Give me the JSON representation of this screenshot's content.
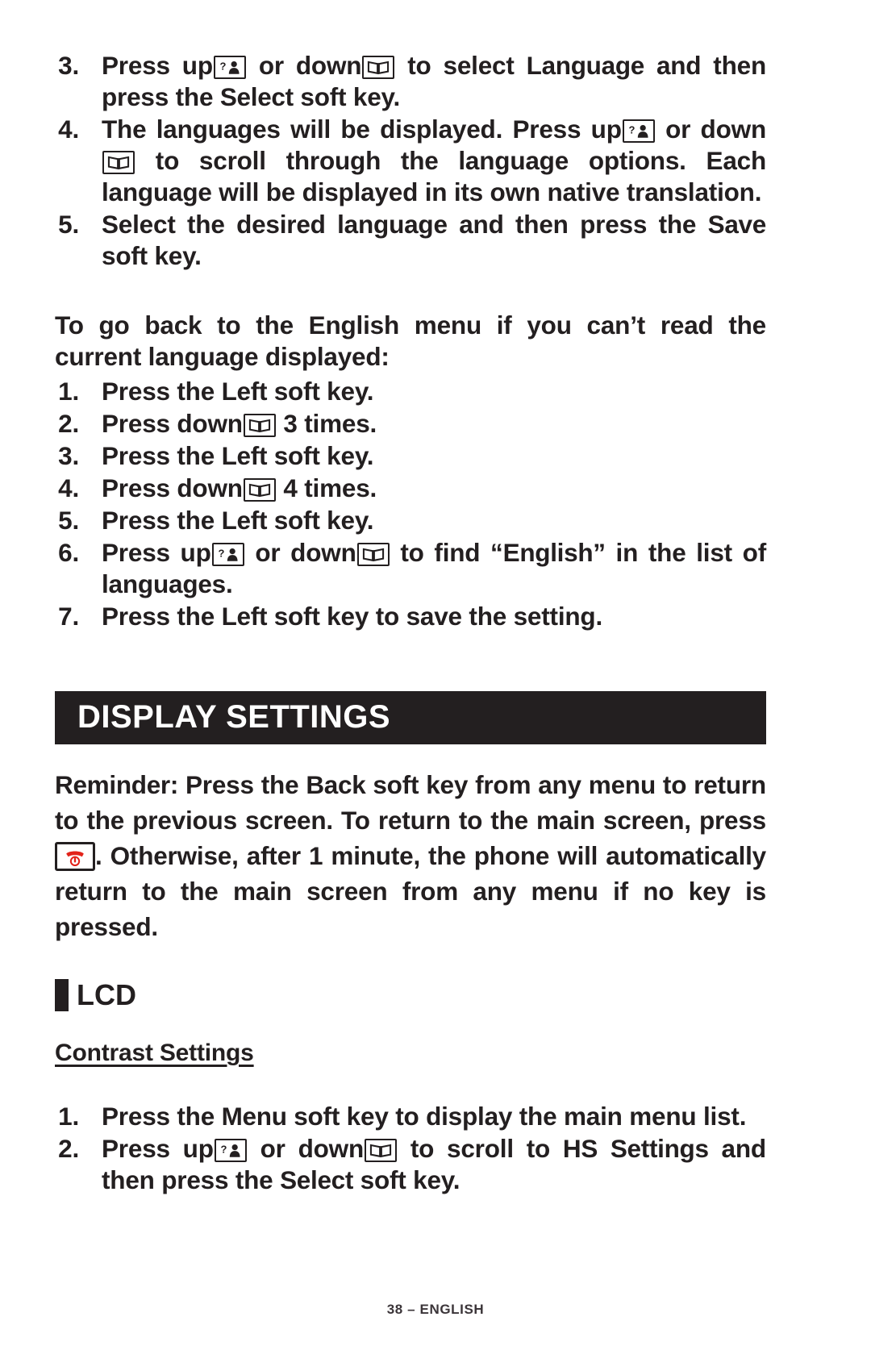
{
  "page": {
    "footer": "38 – ENGLISH",
    "colors": {
      "ink": "#231F20",
      "banner_bg": "#231F20",
      "banner_text": "#FFFFFF",
      "end_key_red": "#E2231A"
    }
  },
  "language_steps": {
    "items": [
      {
        "num": "3.",
        "parts": [
          {
            "t": "text",
            "v": "Press up"
          },
          {
            "t": "icon",
            "v": "up-key-icon"
          },
          {
            "t": "text",
            "v": " or down"
          },
          {
            "t": "icon",
            "v": "down-key-icon"
          },
          {
            "t": "text",
            "v": " to select "
          },
          {
            "t": "bold",
            "v": "Language"
          },
          {
            "t": "text",
            "v": " and then press the "
          },
          {
            "t": "bold",
            "v": "Select"
          },
          {
            "t": "text",
            "v": " soft key."
          }
        ]
      },
      {
        "num": "4.",
        "parts": [
          {
            "t": "text",
            "v": "The languages will be displayed. Press up"
          },
          {
            "t": "icon",
            "v": "up-key-icon"
          },
          {
            "t": "text",
            "v": " or down"
          },
          {
            "t": "icon",
            "v": "down-key-icon"
          },
          {
            "t": "text",
            "v": " to scroll through the language options.  Each language will be displayed in its own native translation."
          }
        ]
      },
      {
        "num": "5.",
        "parts": [
          {
            "t": "text",
            "v": "Select the desired language and then press the "
          },
          {
            "t": "bold",
            "v": "Save"
          },
          {
            "t": "text",
            "v": " soft key."
          }
        ]
      }
    ]
  },
  "english_intro": "To go back to the English menu if you can’t read the current language displayed:",
  "english_steps": {
    "items": [
      {
        "num": "1.",
        "parts": [
          {
            "t": "text",
            "v": "Press the "
          },
          {
            "t": "bold",
            "v": "Left"
          },
          {
            "t": "text",
            "v": " soft key."
          }
        ]
      },
      {
        "num": "2.",
        "parts": [
          {
            "t": "text",
            "v": "Press down"
          },
          {
            "t": "icon",
            "v": "down-key-icon"
          },
          {
            "t": "text",
            "v": " 3 times."
          }
        ]
      },
      {
        "num": "3.",
        "parts": [
          {
            "t": "text",
            "v": "Press the "
          },
          {
            "t": "bold",
            "v": "Left"
          },
          {
            "t": "text",
            "v": " soft key."
          }
        ]
      },
      {
        "num": "4.",
        "parts": [
          {
            "t": "text",
            "v": "Press down"
          },
          {
            "t": "icon",
            "v": "down-key-icon"
          },
          {
            "t": "text",
            "v": " 4 times."
          }
        ]
      },
      {
        "num": "5.",
        "parts": [
          {
            "t": "text",
            "v": "Press the "
          },
          {
            "t": "bold",
            "v": "Left"
          },
          {
            "t": "text",
            "v": " soft key."
          }
        ]
      },
      {
        "num": "6.",
        "parts": [
          {
            "t": "text",
            "v": "Press up"
          },
          {
            "t": "icon",
            "v": "up-key-icon"
          },
          {
            "t": "text",
            "v": " or down"
          },
          {
            "t": "icon",
            "v": "down-key-icon"
          },
          {
            "t": "text",
            "v": " to find “"
          },
          {
            "t": "bold",
            "v": "English"
          },
          {
            "t": "text",
            "v": "” in the list of languages."
          }
        ]
      },
      {
        "num": "7.",
        "parts": [
          {
            "t": "text",
            "v": "Press the "
          },
          {
            "t": "bold",
            "v": "Left"
          },
          {
            "t": "text",
            "v": " soft key to save the setting."
          }
        ]
      }
    ]
  },
  "display_settings": {
    "banner_title": "DISPLAY SETTINGS",
    "reminder": {
      "parts": [
        {
          "t": "bold",
          "v": "Reminder:"
        },
        {
          "t": "text",
          "v": " Press the "
        },
        {
          "t": "bold",
          "v": "Back"
        },
        {
          "t": "text",
          "v": " soft key from any menu to return to the previous screen.  To return to the main screen, press "
        },
        {
          "t": "icon",
          "v": "end-call-key-icon"
        },
        {
          "t": "text",
          "v": ".  Otherwise, after 1 minute, the phone will automatically return to the main screen from any menu if no key is pressed."
        }
      ]
    },
    "lcd": {
      "heading": "LCD",
      "contrast": {
        "heading": "Contrast Settings",
        "items": [
          {
            "num": "1.",
            "parts": [
              {
                "t": "text",
                "v": "Press the "
              },
              {
                "t": "bold",
                "v": "Menu"
              },
              {
                "t": "text",
                "v": " soft key to display the main menu list."
              }
            ]
          },
          {
            "num": "2.",
            "parts": [
              {
                "t": "text",
                "v": "Press up"
              },
              {
                "t": "icon",
                "v": "up-key-icon"
              },
              {
                "t": "text",
                "v": " or down"
              },
              {
                "t": "icon",
                "v": "down-key-icon"
              },
              {
                "t": "text",
                "v": " to scroll to "
              },
              {
                "t": "bold",
                "v": "HS Settings"
              },
              {
                "t": "text",
                "v": " and then press the "
              },
              {
                "t": "bold",
                "v": "Select"
              },
              {
                "t": "text",
                "v": " soft key."
              }
            ]
          }
        ]
      }
    }
  }
}
